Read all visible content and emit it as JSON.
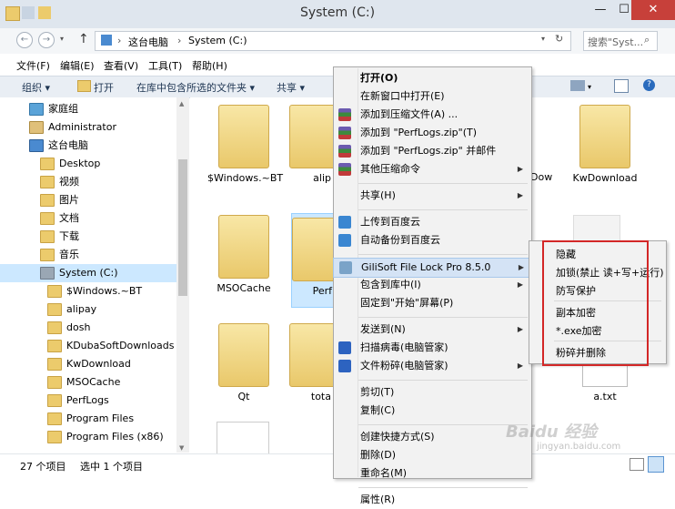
{
  "window": {
    "title": "System (C:)",
    "min": "—",
    "max": "☐",
    "close": "✕"
  },
  "nav": {
    "back": "←",
    "forward": "→",
    "up": "↑",
    "breadcrumb": [
      "这台电脑",
      "System (C:)"
    ],
    "refresh": "↻",
    "search_placeholder": "搜索\"Syst...",
    "sep": "›"
  },
  "menubar": [
    "文件(F)",
    "编辑(E)",
    "查看(V)",
    "工具(T)",
    "帮助(H)"
  ],
  "toolbar": {
    "organize": "组织 ▾",
    "open": "打开",
    "include": "在库中包含所选的文件夹 ▾",
    "share": "共享 ▾"
  },
  "tree": [
    {
      "label": "家庭组",
      "icon": "home"
    },
    {
      "label": "Administrator",
      "icon": "user"
    },
    {
      "label": "这台电脑",
      "icon": "pc"
    },
    {
      "label": "Desktop",
      "icon": "folder"
    },
    {
      "label": "视频",
      "icon": "folder"
    },
    {
      "label": "图片",
      "icon": "folder"
    },
    {
      "label": "文档",
      "icon": "folder"
    },
    {
      "label": "下载",
      "icon": "folder"
    },
    {
      "label": "音乐",
      "icon": "folder"
    },
    {
      "label": "System (C:)",
      "icon": "drive"
    },
    {
      "label": "$Windows.~BT",
      "icon": "folder"
    },
    {
      "label": "alipay",
      "icon": "folder"
    },
    {
      "label": "dosh",
      "icon": "folder"
    },
    {
      "label": "KDubaSoftDownloads",
      "icon": "folder"
    },
    {
      "label": "KwDownload",
      "icon": "folder"
    },
    {
      "label": "MSOCache",
      "icon": "folder"
    },
    {
      "label": "PerfLogs",
      "icon": "folder"
    },
    {
      "label": "Program Files",
      "icon": "folder"
    },
    {
      "label": "Program Files (x86)",
      "icon": "folder"
    }
  ],
  "content": {
    "row1": [
      "$Windows.~BT",
      "alip",
      "Dow",
      "KwDownload"
    ],
    "row2": [
      "MSOCache",
      "Perf"
    ],
    "row3": [
      "Qt",
      "tota",
      "a.txt"
    ]
  },
  "status": {
    "count": "27 个项目",
    "selected": "选中 1 个项目"
  },
  "context_menu": {
    "items": [
      {
        "label": "打开(O)",
        "bold": true
      },
      {
        "label": "在新窗口中打开(E)"
      },
      {
        "label": "添加到压缩文件(A) ...",
        "icon": "rar"
      },
      {
        "label": "添加到 \"PerfLogs.zip\"(T)",
        "icon": "rar"
      },
      {
        "label": "添加到 \"PerfLogs.zip\" 并邮件",
        "icon": "rar"
      },
      {
        "label": "其他压缩命令",
        "icon": "rar",
        "arrow": "▶"
      },
      {
        "sep": true
      },
      {
        "label": "共享(H)",
        "arrow": "▶"
      },
      {
        "sep": true
      },
      {
        "label": "上传到百度云",
        "icon": "cloud"
      },
      {
        "label": "自动备份到百度云",
        "icon": "cloud"
      },
      {
        "sep": true
      },
      {
        "label": "GiliSoft File Lock Pro 8.5.0",
        "icon": "lock",
        "arrow": "▶",
        "highlighted": true
      },
      {
        "label": "包含到库中(I)",
        "arrow": "▶"
      },
      {
        "label": "固定到\"开始\"屏幕(P)"
      },
      {
        "sep": true
      },
      {
        "label": "发送到(N)",
        "arrow": "▶"
      },
      {
        "label": "扫描病毒(电脑管家)",
        "icon": "shield"
      },
      {
        "label": "文件粉碎(电脑管家)",
        "icon": "shield",
        "arrow": "▶"
      },
      {
        "sep": true
      },
      {
        "label": "剪切(T)"
      },
      {
        "label": "复制(C)"
      },
      {
        "sep": true
      },
      {
        "label": "创建快捷方式(S)"
      },
      {
        "label": "删除(D)"
      },
      {
        "label": "重命名(M)"
      },
      {
        "sep": true
      },
      {
        "label": "属性(R)"
      }
    ]
  },
  "submenu": [
    "隐藏",
    "加锁(禁止 读+写+运行)",
    "防写保护",
    "副本加密",
    "*.exe加密",
    "粉碎并删除"
  ],
  "watermark": {
    "brand": "Baidu 经验",
    "url": "jingyan.baidu.com"
  },
  "colors": {
    "highlight": "#d4e3f5",
    "redbox": "#d32727",
    "close": "#c7403a"
  }
}
